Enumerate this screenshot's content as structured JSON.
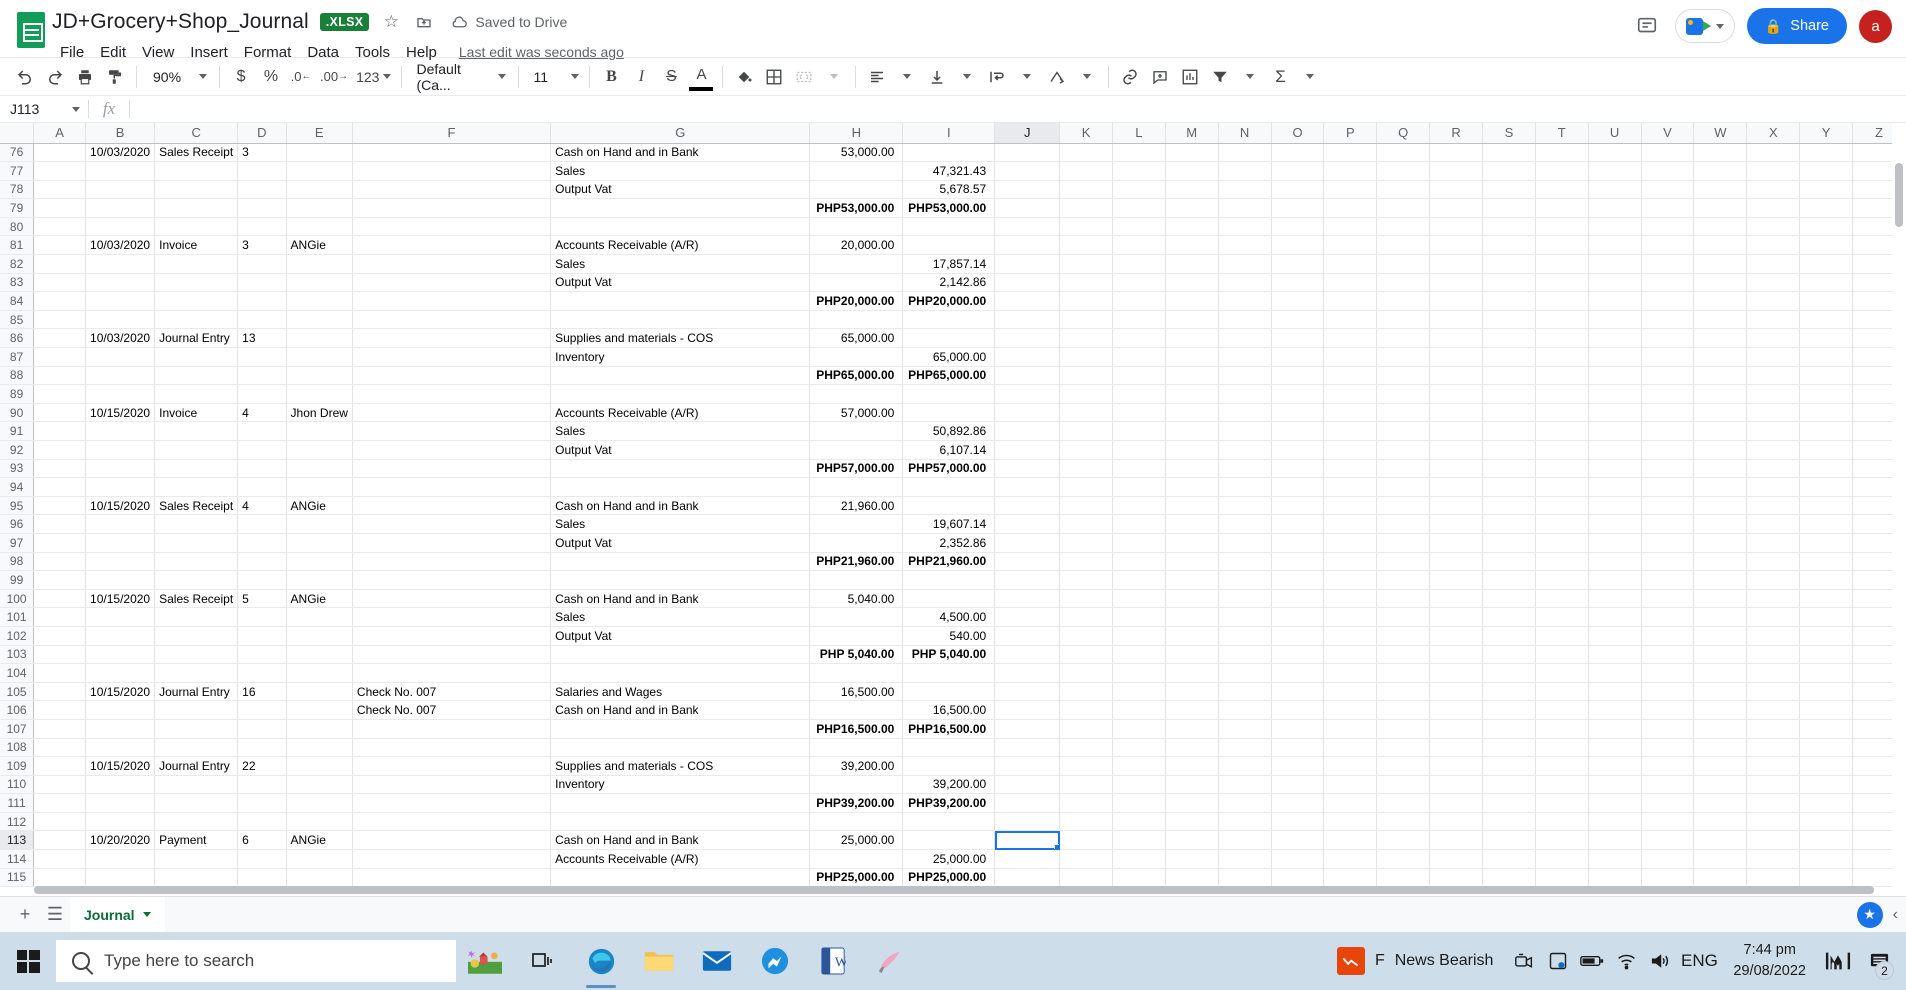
{
  "titlebar": {
    "doc_title": "JD+Grocery+Shop_Journal",
    "file_badge": ".XLSX",
    "star_icon": "star-icon",
    "move_icon": "move-to-folder-icon",
    "cloud_icon": "cloud-saved-icon",
    "save_status": "Saved to Drive",
    "menus": [
      "File",
      "Edit",
      "View",
      "Insert",
      "Format",
      "Data",
      "Tools",
      "Help"
    ],
    "last_edit": "Last edit was seconds ago",
    "comment_history_icon": "comment-history-icon",
    "meet_icon": "meet-camera-icon",
    "share_label": "Share",
    "share_lock_icon": "lock-icon",
    "avatar_letter": "a"
  },
  "toolbar": {
    "undo_icon": "undo-icon",
    "redo_icon": "redo-icon",
    "print_icon": "print-icon",
    "paint_format_icon": "paint-format-icon",
    "zoom_value": "90%",
    "currency_icon": "$",
    "percent_icon": "%",
    "decrease_decimal_icon": ".0",
    "increase_decimal_icon": ".00",
    "more_formats_label": "123",
    "font_family": "Default (Ca...",
    "font_size": "11",
    "bold_icon": "B",
    "italic_icon": "I",
    "strikethrough_icon": "S",
    "text_color_icon": "A",
    "fill_color_icon": "fill-color-icon",
    "borders_icon": "borders-icon",
    "merge_cells_icon": "merge-cells-icon",
    "halign_icon": "horizontal-align-icon",
    "valign_icon": "vertical-align-icon",
    "text_wrap_icon": "text-wrapping-icon",
    "text_rotation_icon": "text-rotation-icon",
    "link_icon": "insert-link-icon",
    "comment_icon": "insert-comment-icon",
    "chart_icon": "insert-chart-icon",
    "filter_icon": "filter-icon",
    "functions_icon": "functions-sigma-icon"
  },
  "formulabar": {
    "name_box": "J113",
    "fx_label": "fx",
    "formula_value": ""
  },
  "grid": {
    "columns": [
      "A",
      "B",
      "C",
      "D",
      "E",
      "F",
      "G",
      "H",
      "I",
      "J",
      "K",
      "L",
      "M",
      "N",
      "O",
      "P",
      "Q",
      "R",
      "S",
      "T",
      "U",
      "V",
      "W",
      "X",
      "Y",
      "Z"
    ],
    "selected_column": "J",
    "selected_row": "113",
    "selected_cell": "J113",
    "rows": [
      {
        "n": "76",
        "B": "10/03/2020",
        "C": "Sales Receipt",
        "D": "3",
        "E": "",
        "F": "",
        "G": "Cash on Hand and in Bank",
        "H": "53,000.00",
        "I": "",
        "Hstyle": "num",
        "Istyle": "num"
      },
      {
        "n": "77",
        "B": "",
        "C": "",
        "D": "",
        "E": "",
        "F": "",
        "G": "Sales",
        "H": "",
        "I": "47,321.43",
        "Hstyle": "num",
        "Istyle": "num"
      },
      {
        "n": "78",
        "B": "",
        "C": "",
        "D": "",
        "E": "",
        "F": "",
        "G": "Output Vat",
        "H": "",
        "I": "5,678.57",
        "Hstyle": "num",
        "Istyle": "num"
      },
      {
        "n": "79",
        "B": "",
        "C": "",
        "D": "",
        "E": "",
        "F": "",
        "G": "",
        "H": "PHP53,000.00",
        "I": "PHP53,000.00",
        "Hstyle": "tot",
        "Istyle": "tot"
      },
      {
        "n": "80",
        "B": "",
        "C": "",
        "D": "",
        "E": "",
        "F": "",
        "G": "",
        "H": "",
        "I": "",
        "Hstyle": "num",
        "Istyle": "num"
      },
      {
        "n": "81",
        "B": "10/03/2020",
        "C": "Invoice",
        "D": "3",
        "E": "ANGie",
        "F": "",
        "G": "Accounts Receivable (A/R)",
        "H": "20,000.00",
        "I": "",
        "Hstyle": "num",
        "Istyle": "num"
      },
      {
        "n": "82",
        "B": "",
        "C": "",
        "D": "",
        "E": "",
        "F": "",
        "G": "Sales",
        "H": "",
        "I": "17,857.14",
        "Hstyle": "num",
        "Istyle": "num"
      },
      {
        "n": "83",
        "B": "",
        "C": "",
        "D": "",
        "E": "",
        "F": "",
        "G": "Output Vat",
        "H": "",
        "I": "2,142.86",
        "Hstyle": "num",
        "Istyle": "num"
      },
      {
        "n": "84",
        "B": "",
        "C": "",
        "D": "",
        "E": "",
        "F": "",
        "G": "",
        "H": "PHP20,000.00",
        "I": "PHP20,000.00",
        "Hstyle": "tot",
        "Istyle": "tot"
      },
      {
        "n": "85",
        "B": "",
        "C": "",
        "D": "",
        "E": "",
        "F": "",
        "G": "",
        "H": "",
        "I": "",
        "Hstyle": "num",
        "Istyle": "num"
      },
      {
        "n": "86",
        "B": "10/03/2020",
        "C": "Journal Entry",
        "D": "13",
        "E": "",
        "F": "",
        "G": "Supplies and materials - COS",
        "H": "65,000.00",
        "I": "",
        "Hstyle": "num",
        "Istyle": "num"
      },
      {
        "n": "87",
        "B": "",
        "C": "",
        "D": "",
        "E": "",
        "F": "",
        "G": "Inventory",
        "H": "",
        "I": "65,000.00",
        "Hstyle": "num",
        "Istyle": "num"
      },
      {
        "n": "88",
        "B": "",
        "C": "",
        "D": "",
        "E": "",
        "F": "",
        "G": "",
        "H": "PHP65,000.00",
        "I": "PHP65,000.00",
        "Hstyle": "tot",
        "Istyle": "tot"
      },
      {
        "n": "89",
        "B": "",
        "C": "",
        "D": "",
        "E": "",
        "F": "",
        "G": "",
        "H": "",
        "I": "",
        "Hstyle": "num",
        "Istyle": "num"
      },
      {
        "n": "90",
        "B": "10/15/2020",
        "C": "Invoice",
        "D": "4",
        "E": "Jhon Drew",
        "F": "",
        "G": "Accounts Receivable (A/R)",
        "H": "57,000.00",
        "I": "",
        "Hstyle": "num",
        "Istyle": "num"
      },
      {
        "n": "91",
        "B": "",
        "C": "",
        "D": "",
        "E": "",
        "F": "",
        "G": "Sales",
        "H": "",
        "I": "50,892.86",
        "Hstyle": "num",
        "Istyle": "num"
      },
      {
        "n": "92",
        "B": "",
        "C": "",
        "D": "",
        "E": "",
        "F": "",
        "G": "Output Vat",
        "H": "",
        "I": "6,107.14",
        "Hstyle": "num",
        "Istyle": "num"
      },
      {
        "n": "93",
        "B": "",
        "C": "",
        "D": "",
        "E": "",
        "F": "",
        "G": "",
        "H": "PHP57,000.00",
        "I": "PHP57,000.00",
        "Hstyle": "tot",
        "Istyle": "tot"
      },
      {
        "n": "94",
        "B": "",
        "C": "",
        "D": "",
        "E": "",
        "F": "",
        "G": "",
        "H": "",
        "I": "",
        "Hstyle": "num",
        "Istyle": "num"
      },
      {
        "n": "95",
        "B": "10/15/2020",
        "C": "Sales Receipt",
        "D": "4",
        "E": "ANGie",
        "F": "",
        "G": "Cash on Hand and in Bank",
        "H": "21,960.00",
        "I": "",
        "Hstyle": "num",
        "Istyle": "num"
      },
      {
        "n": "96",
        "B": "",
        "C": "",
        "D": "",
        "E": "",
        "F": "",
        "G": "Sales",
        "H": "",
        "I": "19,607.14",
        "Hstyle": "num",
        "Istyle": "num"
      },
      {
        "n": "97",
        "B": "",
        "C": "",
        "D": "",
        "E": "",
        "F": "",
        "G": "Output Vat",
        "H": "",
        "I": "2,352.86",
        "Hstyle": "num",
        "Istyle": "num"
      },
      {
        "n": "98",
        "B": "",
        "C": "",
        "D": "",
        "E": "",
        "F": "",
        "G": "",
        "H": "PHP21,960.00",
        "I": "PHP21,960.00",
        "Hstyle": "tot",
        "Istyle": "tot"
      },
      {
        "n": "99",
        "B": "",
        "C": "",
        "D": "",
        "E": "",
        "F": "",
        "G": "",
        "H": "",
        "I": "",
        "Hstyle": "num",
        "Istyle": "num"
      },
      {
        "n": "100",
        "B": "10/15/2020",
        "C": "Sales Receipt",
        "D": "5",
        "E": "ANGie",
        "F": "",
        "G": "Cash on Hand and in Bank",
        "H": "5,040.00",
        "I": "",
        "Hstyle": "num",
        "Istyle": "num"
      },
      {
        "n": "101",
        "B": "",
        "C": "",
        "D": "",
        "E": "",
        "F": "",
        "G": "Sales",
        "H": "",
        "I": "4,500.00",
        "Hstyle": "num",
        "Istyle": "num"
      },
      {
        "n": "102",
        "B": "",
        "C": "",
        "D": "",
        "E": "",
        "F": "",
        "G": "Output Vat",
        "H": "",
        "I": "540.00",
        "Hstyle": "num",
        "Istyle": "num"
      },
      {
        "n": "103",
        "B": "",
        "C": "",
        "D": "",
        "E": "",
        "F": "",
        "G": "",
        "H": "PHP  5,040.00",
        "I": "PHP  5,040.00",
        "Hstyle": "tot",
        "Istyle": "tot"
      },
      {
        "n": "104",
        "B": "",
        "C": "",
        "D": "",
        "E": "",
        "F": "",
        "G": "",
        "H": "",
        "I": "",
        "Hstyle": "num",
        "Istyle": "num"
      },
      {
        "n": "105",
        "B": "10/15/2020",
        "C": "Journal Entry",
        "D": "16",
        "E": "",
        "F": "Check No. 007",
        "G": "Salaries and Wages",
        "H": "16,500.00",
        "I": "",
        "Hstyle": "num",
        "Istyle": "num"
      },
      {
        "n": "106",
        "B": "",
        "C": "",
        "D": "",
        "E": "",
        "F": "Check No. 007",
        "G": "Cash on Hand and in Bank",
        "H": "",
        "I": "16,500.00",
        "Hstyle": "num",
        "Istyle": "num"
      },
      {
        "n": "107",
        "B": "",
        "C": "",
        "D": "",
        "E": "",
        "F": "",
        "G": "",
        "H": "PHP16,500.00",
        "I": "PHP16,500.00",
        "Hstyle": "tot",
        "Istyle": "tot"
      },
      {
        "n": "108",
        "B": "",
        "C": "",
        "D": "",
        "E": "",
        "F": "",
        "G": "",
        "H": "",
        "I": "",
        "Hstyle": "num",
        "Istyle": "num"
      },
      {
        "n": "109",
        "B": "10/15/2020",
        "C": "Journal Entry",
        "D": "22",
        "E": "",
        "F": "",
        "G": "Supplies and materials - COS",
        "H": "39,200.00",
        "I": "",
        "Hstyle": "num",
        "Istyle": "num"
      },
      {
        "n": "110",
        "B": "",
        "C": "",
        "D": "",
        "E": "",
        "F": "",
        "G": "Inventory",
        "H": "",
        "I": "39,200.00",
        "Hstyle": "num",
        "Istyle": "num"
      },
      {
        "n": "111",
        "B": "",
        "C": "",
        "D": "",
        "E": "",
        "F": "",
        "G": "",
        "H": "PHP39,200.00",
        "I": "PHP39,200.00",
        "Hstyle": "tot",
        "Istyle": "tot"
      },
      {
        "n": "112",
        "B": "",
        "C": "",
        "D": "",
        "E": "",
        "F": "",
        "G": "",
        "H": "",
        "I": "",
        "Hstyle": "num",
        "Istyle": "num"
      },
      {
        "n": "113",
        "B": "10/20/2020",
        "C": "Payment",
        "D": "6",
        "E": "ANGie",
        "F": "",
        "G": "Cash on Hand and in Bank",
        "H": "25,000.00",
        "I": "",
        "Hstyle": "num",
        "Istyle": "num"
      },
      {
        "n": "114",
        "B": "",
        "C": "",
        "D": "",
        "E": "",
        "F": "",
        "G": "Accounts Receivable (A/R)",
        "H": "",
        "I": "25,000.00",
        "Hstyle": "num",
        "Istyle": "num"
      },
      {
        "n": "115",
        "B": "",
        "C": "",
        "D": "",
        "E": "",
        "F": "",
        "G": "",
        "H": "PHP25,000.00",
        "I": "PHP25,000.00",
        "Hstyle": "tot",
        "Istyle": "tot"
      }
    ]
  },
  "sheetbar": {
    "add_sheet_icon": "add-sheet-icon",
    "all_sheets_icon": "all-sheets-icon",
    "tab_name": "Journal",
    "explore_icon": "explore-icon",
    "collapse_icon": "collapse-icon"
  },
  "taskbar": {
    "start_icon": "windows-start-icon",
    "search_placeholder": "Type here to search",
    "apps": [
      "news-weather-icon",
      "task-view-icon",
      "edge-browser-icon",
      "file-explorer-icon",
      "mail-icon",
      "messenger-icon",
      "word-icon",
      "paint-icon"
    ],
    "news_label": "News Bearish",
    "news_prefix": "F",
    "tray": [
      "meet-now-icon",
      "onedrive-icon",
      "battery-icon",
      "wifi-icon",
      "volume-icon"
    ],
    "language": "ENG",
    "time": "7:44 pm",
    "date": "29/08/2022",
    "extra_icon": "mi-icon",
    "notification_icon": "notification-icon",
    "notification_count": "2"
  },
  "colors": {
    "brand_green": "#0f9d58",
    "accent_blue": "#1a73e8",
    "taskbar_bg": "#cdddea",
    "selection_blue": "#1a73e8"
  }
}
